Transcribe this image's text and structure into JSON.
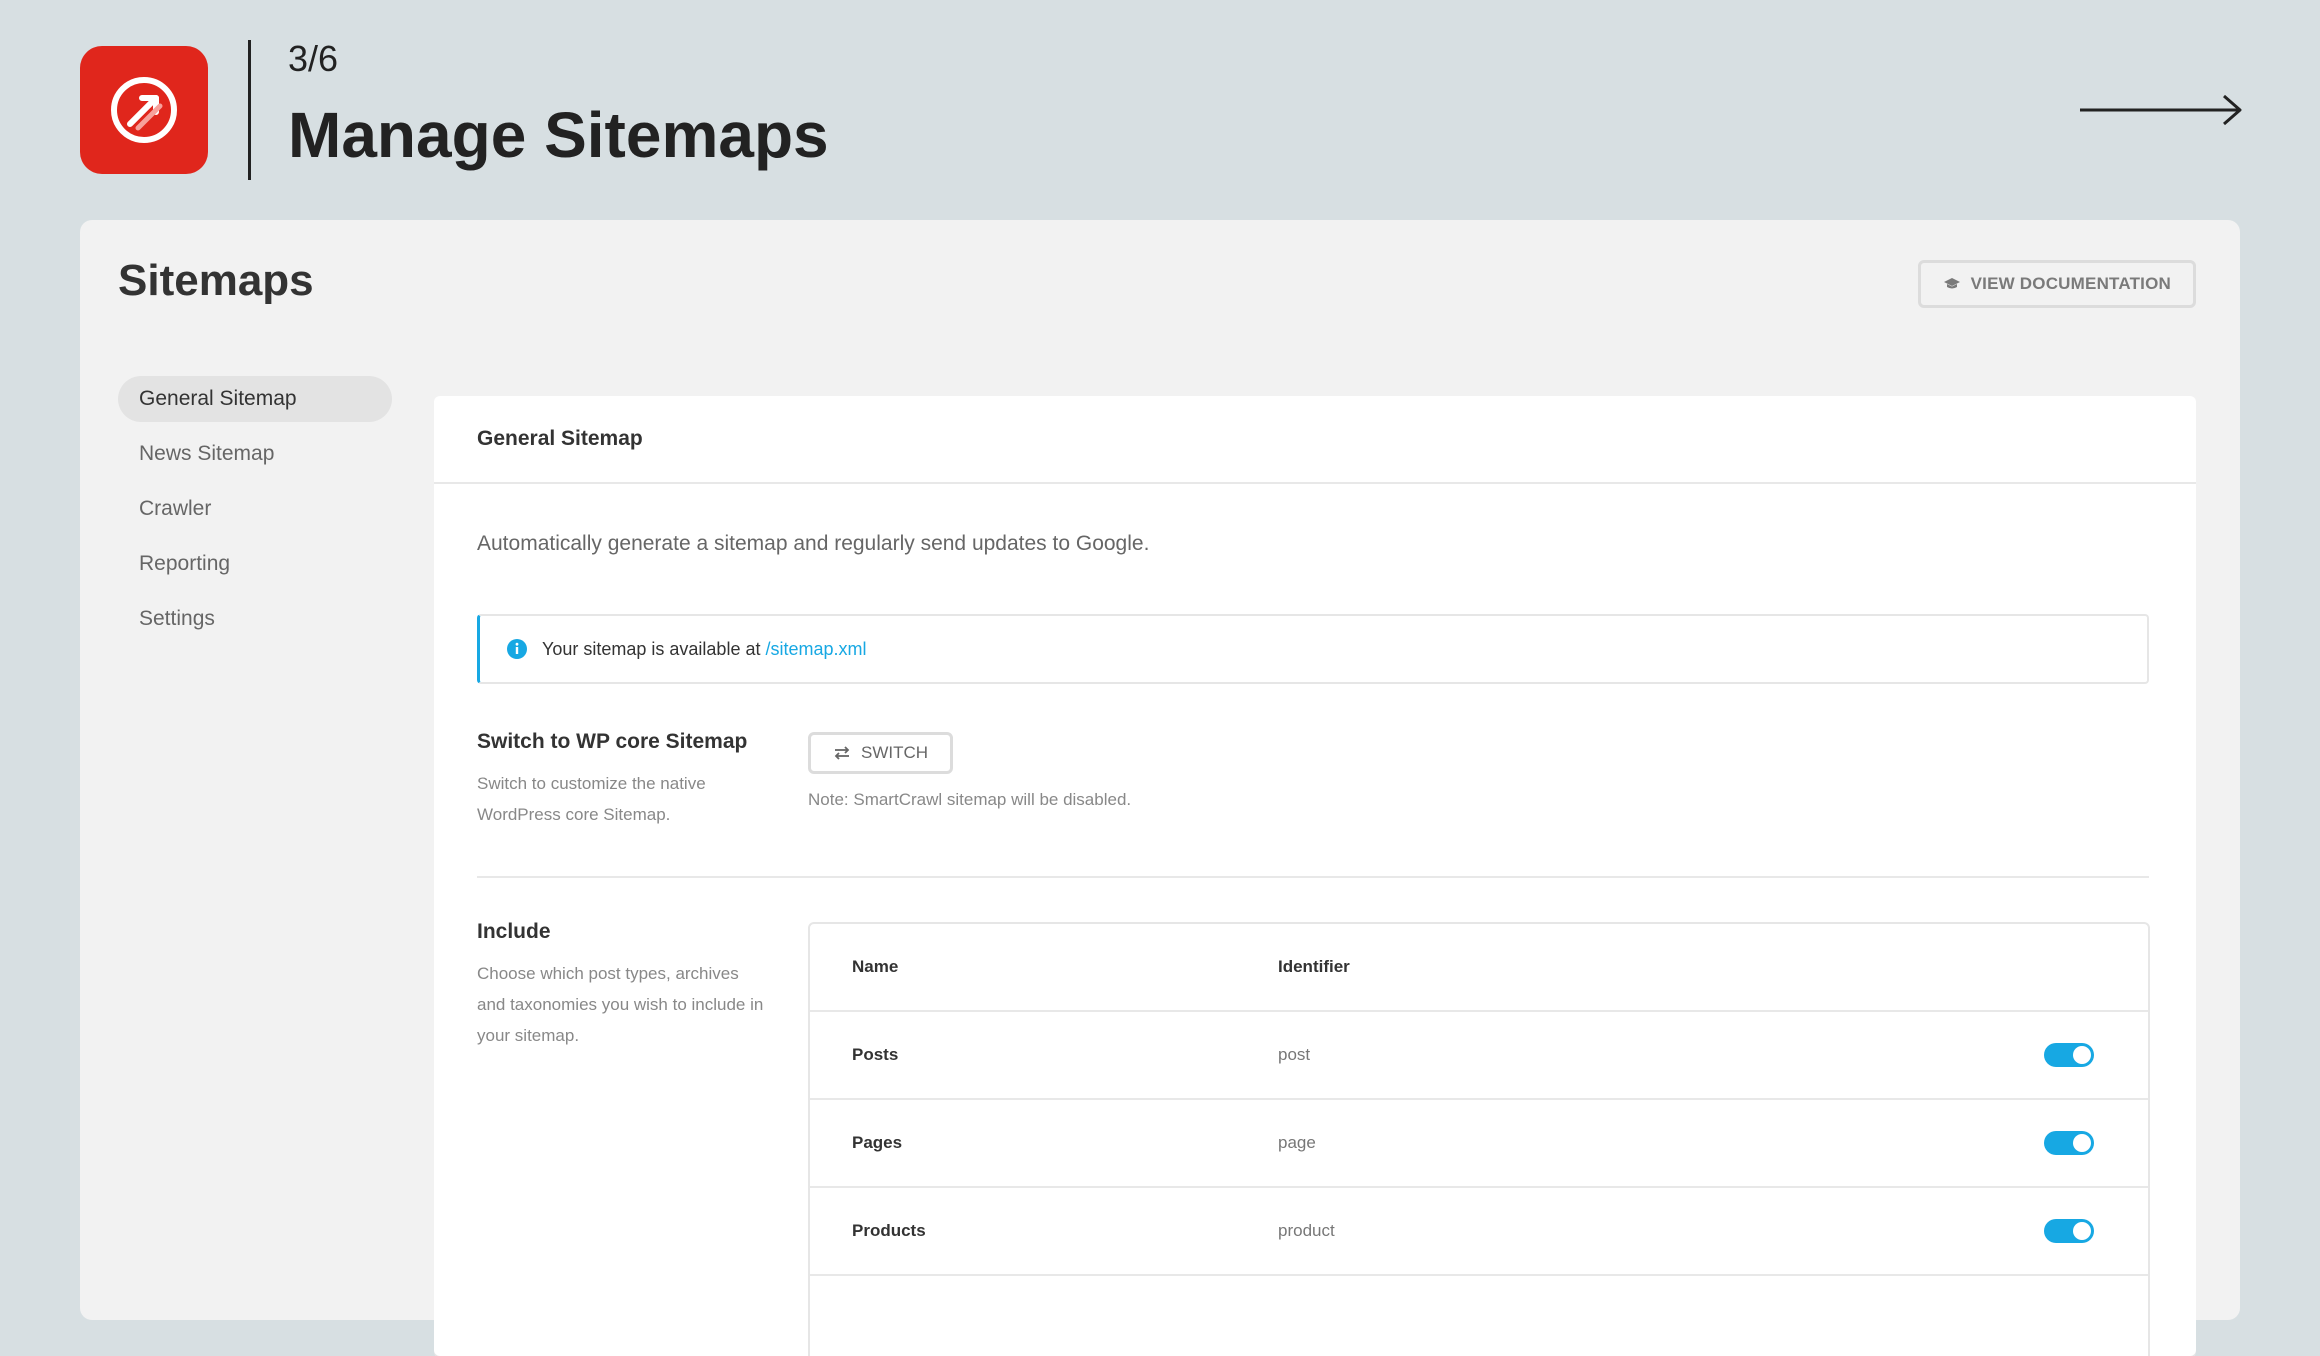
{
  "header": {
    "step": "3/6",
    "title": "Manage Sitemaps"
  },
  "panel": {
    "title": "Sitemaps",
    "doc_button_label": "VIEW DOCUMENTATION"
  },
  "sidebar": {
    "items": [
      {
        "label": "General Sitemap",
        "active": true
      },
      {
        "label": "News Sitemap",
        "active": false
      },
      {
        "label": "Crawler",
        "active": false
      },
      {
        "label": "Reporting",
        "active": false
      },
      {
        "label": "Settings",
        "active": false
      }
    ]
  },
  "content": {
    "header": "General Sitemap",
    "description": "Automatically generate a sitemap and regularly send updates to Google.",
    "notice": {
      "text": "Your sitemap is available at",
      "link": "/sitemap.xml"
    },
    "switch_section": {
      "label": "Switch to WP core Sitemap",
      "help": "Switch to customize the native WordPress core Sitemap.",
      "button_label": "SWITCH",
      "note": "Note: SmartCrawl sitemap will be disabled."
    },
    "include_section": {
      "label": "Include",
      "help": "Choose which post types, archives and taxonomies you wish to include in your sitemap.",
      "columns": [
        "Name",
        "Identifier"
      ],
      "rows": [
        {
          "name": "Posts",
          "identifier": "post",
          "enabled": true
        },
        {
          "name": "Pages",
          "identifier": "page",
          "enabled": true
        },
        {
          "name": "Products",
          "identifier": "product",
          "enabled": true
        }
      ]
    }
  },
  "colors": {
    "brand": "#e0261c",
    "accent": "#17a8e3",
    "background": "#d7dfe2"
  },
  "icons": {
    "logo": "smartcrawl-logo-icon",
    "next": "arrow-right-icon",
    "docs": "graduation-cap-icon",
    "info": "info-icon",
    "switch": "swap-arrows-icon"
  }
}
